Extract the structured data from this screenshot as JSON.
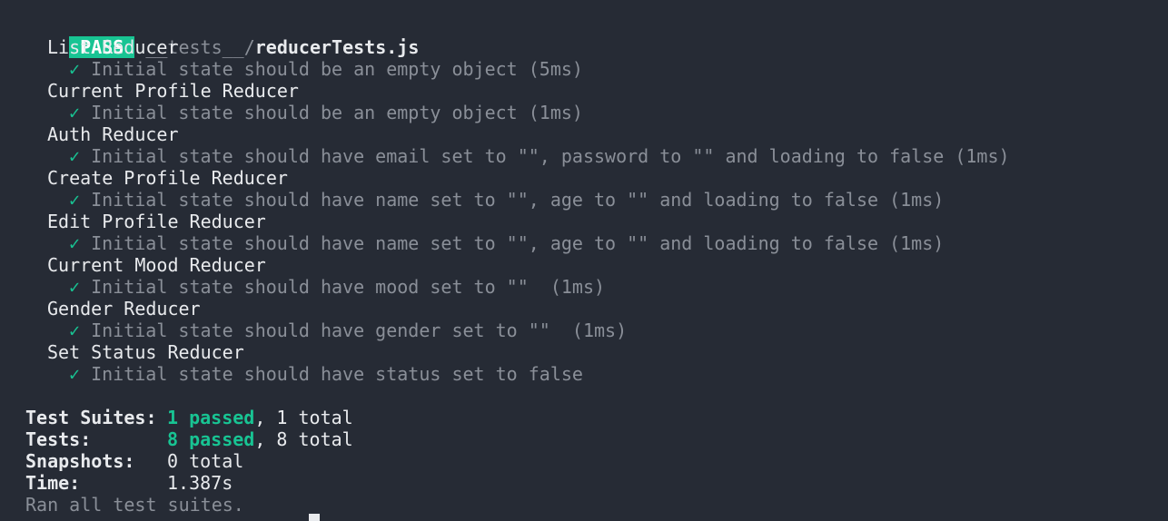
{
  "header": {
    "badge": "PASS",
    "path_dir": "__tests__/",
    "path_file": "reducerTests.js"
  },
  "check_mark": "✓",
  "suites": [
    {
      "name": "List Reducer",
      "test": "Initial state should be an empty object (5ms)"
    },
    {
      "name": "Current Profile Reducer",
      "test": "Initial state should be an empty object (1ms)"
    },
    {
      "name": "Auth Reducer",
      "test": "Initial state should have email set to \"\", password to \"\" and loading to false (1ms)"
    },
    {
      "name": "Create Profile Reducer",
      "test": "Initial state should have name set to \"\", age to \"\" and loading to false (1ms)"
    },
    {
      "name": "Edit Profile Reducer",
      "test": "Initial state should have name set to \"\", age to \"\" and loading to false (1ms)"
    },
    {
      "name": "Current Mood Reducer",
      "test": "Initial state should have mood set to \"\"  (1ms)"
    },
    {
      "name": "Gender Reducer",
      "test": "Initial state should have gender set to \"\"  (1ms)"
    },
    {
      "name": "Set Status Reducer",
      "test": "Initial state should have status set to false"
    }
  ],
  "summary": {
    "suites_label": "Test Suites:",
    "suites_passed": "1 passed",
    "suites_total": ", 1 total",
    "tests_label": "Tests:",
    "tests_passed": "8 passed",
    "tests_total": ", 8 total",
    "snapshots_label": "Snapshots:",
    "snapshots_value": "0 total",
    "time_label": "Time:",
    "time_value": "1.387s",
    "ran_all": "Ran all test suites."
  },
  "colors": {
    "background": "#262b35",
    "pass_green": "#18c493",
    "text": "#e8eaed",
    "dim": "#8a8f98"
  }
}
